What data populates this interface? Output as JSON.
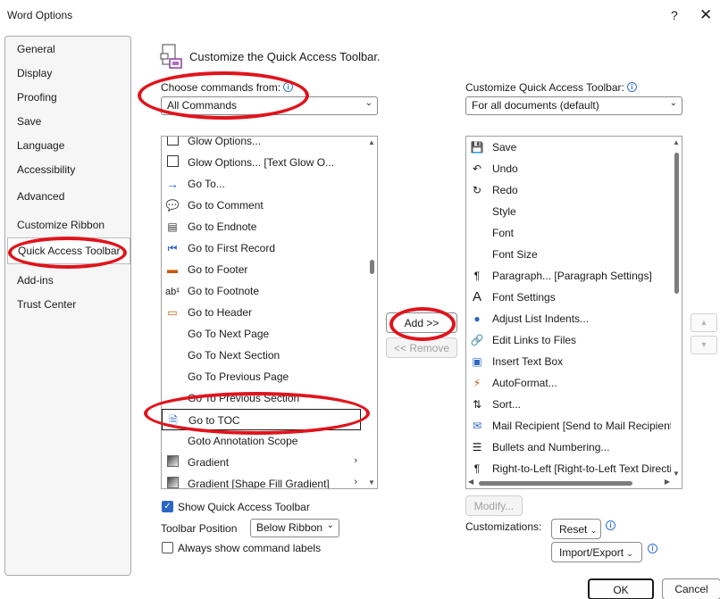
{
  "window": {
    "title": "Word Options",
    "help": "?",
    "close": "✕"
  },
  "nav": {
    "items": [
      {
        "label": "General"
      },
      {
        "label": "Display"
      },
      {
        "label": "Proofing"
      },
      {
        "label": "Save"
      },
      {
        "label": "Language"
      },
      {
        "label": "Accessibility"
      },
      {
        "label": "Advanced"
      },
      {
        "label": "Customize Ribbon"
      },
      {
        "label": "Quick Access Toolbar",
        "selected": true
      },
      {
        "label": "Add-ins"
      },
      {
        "label": "Trust Center"
      }
    ]
  },
  "header": {
    "text": "Customize the Quick Access Toolbar."
  },
  "choose": {
    "label": "Choose commands from:",
    "value": "All Commands"
  },
  "customize": {
    "label": "Customize Quick Access Toolbar:",
    "value": "For all documents (default)"
  },
  "commands": [
    {
      "label": "Glow Options...",
      "icon": "checkbox-icon"
    },
    {
      "label": "Glow Options... [Text Glow O...",
      "icon": "checkbox-icon"
    },
    {
      "label": "Go To...",
      "icon": "arrow-right-icon"
    },
    {
      "label": "Go to Comment",
      "icon": "comment-icon"
    },
    {
      "label": "Go to Endnote",
      "icon": "endnote-icon"
    },
    {
      "label": "Go to First Record",
      "icon": "first-record-icon"
    },
    {
      "label": "Go to Footer",
      "icon": "footer-icon"
    },
    {
      "label": "Go to Footnote",
      "icon": "footnote-icon"
    },
    {
      "label": "Go to Header",
      "icon": "header-icon"
    },
    {
      "label": "Go To Next Page",
      "icon": ""
    },
    {
      "label": "Go To Next Section",
      "icon": ""
    },
    {
      "label": "Go To Previous Page",
      "icon": ""
    },
    {
      "label": "Go To Previous Section",
      "icon": ""
    },
    {
      "label": "Go to TOC",
      "icon": "toc-icon",
      "selected": true
    },
    {
      "label": "Goto Annotation Scope",
      "icon": ""
    },
    {
      "label": "Gradient",
      "icon": "gradient-icon",
      "submenu": true
    },
    {
      "label": "Gradient [Shape Fill Gradient]",
      "icon": "gradient-icon",
      "submenu": true
    }
  ],
  "toolbar_items": [
    {
      "label": "Save",
      "icon": "save-icon"
    },
    {
      "label": "Undo",
      "icon": "undo-icon"
    },
    {
      "label": "Redo",
      "icon": "redo-icon"
    },
    {
      "label": "Style",
      "icon": ""
    },
    {
      "label": "Font",
      "icon": ""
    },
    {
      "label": "Font Size",
      "icon": ""
    },
    {
      "label": "Paragraph... [Paragraph Settings]",
      "icon": "paragraph-icon"
    },
    {
      "label": "Font Settings",
      "icon": "font-icon"
    },
    {
      "label": "Adjust List Indents...",
      "icon": "indent-icon"
    },
    {
      "label": "Edit Links to Files",
      "icon": "link-icon"
    },
    {
      "label": "Insert Text Box",
      "icon": "textbox-icon"
    },
    {
      "label": "AutoFormat...",
      "icon": "autoformat-icon"
    },
    {
      "label": "Sort...",
      "icon": "sort-icon"
    },
    {
      "label": "Mail Recipient [Send to Mail Recipient]",
      "icon": "mail-icon"
    },
    {
      "label": "Bullets and Numbering...",
      "icon": "bullets-icon"
    },
    {
      "label": "Right-to-Left [Right-to-Left Text Direction]",
      "icon": "rtl-icon"
    }
  ],
  "buttons": {
    "add": "Add >>",
    "remove": "<< Remove",
    "modify": "Modify...",
    "reset": "Reset",
    "import_export": "Import/Export",
    "ok": "OK",
    "cancel": "Cancel"
  },
  "options": {
    "show_qat": {
      "label": "Show Quick Access Toolbar",
      "checked": true
    },
    "toolbar_position_label": "Toolbar Position",
    "toolbar_position_value": "Below Ribbon",
    "always_labels": {
      "label": "Always show command labels",
      "checked": false
    }
  },
  "customizations_label": "Customizations:",
  "colors": {
    "accent": "#2b66c4",
    "annotation": "#e0141c"
  }
}
